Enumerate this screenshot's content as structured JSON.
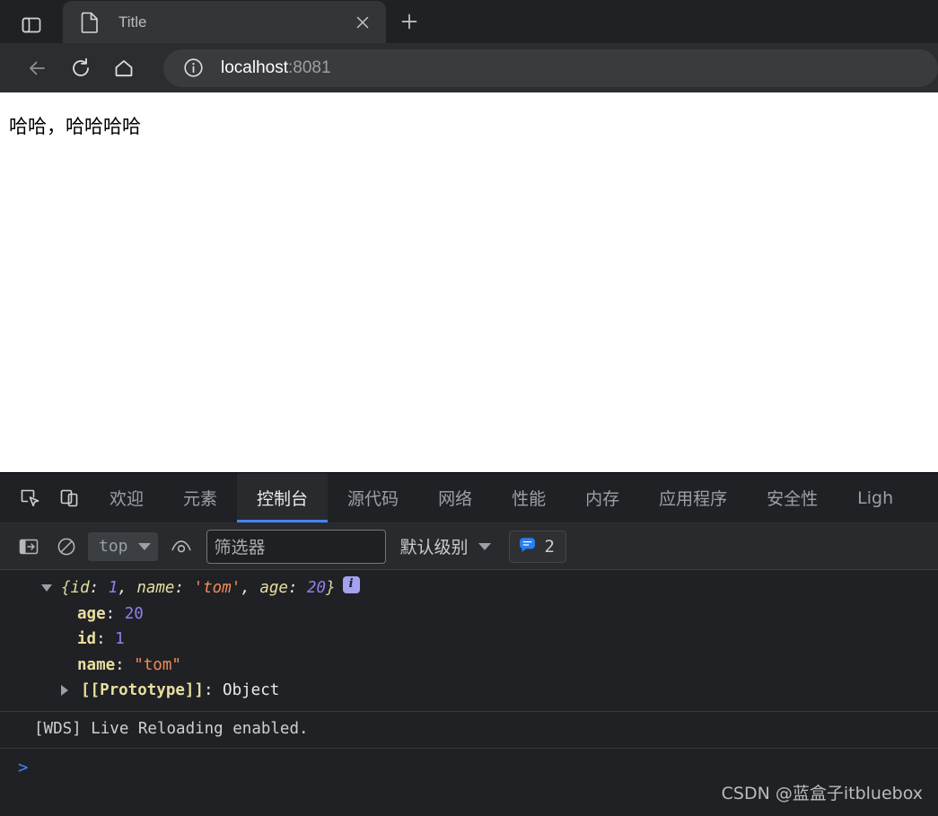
{
  "browser": {
    "tab": {
      "title": "Title",
      "favicon_icon": "page-icon",
      "close_icon": "close-icon"
    },
    "tab_search_icon": "tab-search-icon",
    "new_tab_icon": "plus-icon",
    "nav": {
      "back_icon": "back-arrow-icon",
      "reload_icon": "reload-icon",
      "home_icon": "home-icon"
    },
    "omnibox": {
      "info_icon": "info-circle-icon",
      "host": "localhost",
      "port": ":8081"
    }
  },
  "page": {
    "text": "哈哈，哈哈哈哈"
  },
  "devtools": {
    "inspect_icon": "inspect-element-icon",
    "device_icon": "device-toolbar-icon",
    "tabs": [
      {
        "label": "欢迎",
        "active": false
      },
      {
        "label": "元素",
        "active": false
      },
      {
        "label": "控制台",
        "active": true
      },
      {
        "label": "源代码",
        "active": false
      },
      {
        "label": "网络",
        "active": false
      },
      {
        "label": "性能",
        "active": false
      },
      {
        "label": "内存",
        "active": false
      },
      {
        "label": "应用程序",
        "active": false
      },
      {
        "label": "安全性",
        "active": false
      },
      {
        "label": "Ligh",
        "active": false
      }
    ],
    "console_toolbar": {
      "sidebar_icon": "console-sidebar-icon",
      "clear_icon": "clear-console-icon",
      "context_value": "top",
      "eye_icon": "live-expression-icon",
      "filter_placeholder": "筛选器",
      "level_label": "默认级别",
      "message_badge_icon": "message-bubble-icon",
      "message_count": "2"
    },
    "console_messages": [
      {
        "type": "object",
        "expanded": true,
        "preview": {
          "open": "{",
          "parts": [
            {
              "key": "id",
              "sep": ": ",
              "value": "1",
              "value_type": "num",
              "tail": ", "
            },
            {
              "key": "name",
              "sep": ": ",
              "value": "'tom'",
              "value_type": "str",
              "tail": ", "
            },
            {
              "key": "age",
              "sep": ": ",
              "value": "20",
              "value_type": "num",
              "tail": ""
            }
          ],
          "close": "}"
        },
        "info_chip": "i",
        "properties": [
          {
            "name": "age",
            "value": "20",
            "value_type": "num"
          },
          {
            "name": "id",
            "value": "1",
            "value_type": "num"
          },
          {
            "name": "name",
            "value": "\"tom\"",
            "value_type": "str"
          }
        ],
        "prototype_label": "[[Prototype]]",
        "prototype_value": "Object"
      },
      {
        "type": "text",
        "text": "[WDS] Live Reloading enabled."
      }
    ],
    "prompt_symbol": ">"
  },
  "watermark": {
    "text": "CSDN @蓝盒子itbluebox"
  },
  "colors": {
    "accent_blue": "#4285f4",
    "chrome_bg": "#202124",
    "tab_bg": "#323639",
    "console_bg": "#202124",
    "string_orange": "#f28b54",
    "number_purple": "#8f7ff5",
    "key_yellow": "#e8dfa0"
  }
}
